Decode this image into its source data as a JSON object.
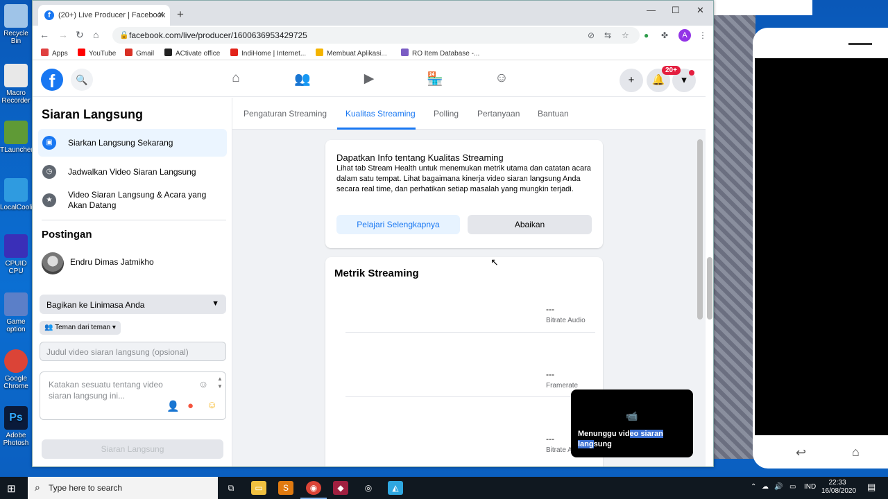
{
  "desktop": {
    "icons": [
      {
        "label": "Recycle Bin",
        "color": "#9fc4e8"
      },
      {
        "label": "Macro Recorder",
        "color": "#e8e8e8"
      },
      {
        "label": "TLauncher",
        "color": "#5f9a36"
      },
      {
        "label": "LocalCooling",
        "color": "#2f9be0"
      },
      {
        "label": "CPUID CPU",
        "color": "#3a2fb8"
      },
      {
        "label": "Game option",
        "color": "#5b7fc8"
      },
      {
        "label": "Google Chrome",
        "color": "#db4437"
      },
      {
        "label": "Adobe Photosh",
        "color": "#0a1a3a"
      }
    ]
  },
  "browser": {
    "tab_title": "(20+) Live Producer | Facebook",
    "url": "facebook.com/live/producer/1600636953429725",
    "bookmarks": [
      {
        "label": "Apps",
        "color": "#e04040"
      },
      {
        "label": "YouTube",
        "color": "#ff0000"
      },
      {
        "label": "Gmail",
        "color": "#d93025"
      },
      {
        "label": "ACtivate office",
        "color": "#222222"
      },
      {
        "label": "IndiHome | Internet...",
        "color": "#e2231a"
      },
      {
        "label": "Membuat Aplikasi...",
        "color": "#f4b400"
      },
      {
        "label": "RO Item Database -...",
        "color": "#7a5cc4"
      }
    ]
  },
  "fb_header": {
    "logo": "f",
    "notification_count": "20+",
    "brand_color": "#1877f2"
  },
  "left_panel": {
    "title": "Siaran Langsung",
    "menu": [
      {
        "label": "Siarkan Langsung Sekarang",
        "icon": "camera-icon"
      },
      {
        "label": "Jadwalkan Video Siaran Langsung",
        "icon": "clock-icon"
      },
      {
        "label": "Video Siaran Langsung & Acara yang Akan Datang",
        "icon": "calendar-icon"
      }
    ],
    "post_section_title": "Postingan",
    "user_name": "Endru Dimas Jatmikho",
    "share_select": "Bagikan ke Linimasa Anda",
    "audience": "Teman dari teman",
    "title_placeholder": "Judul video siaran langsung (opsional)",
    "desc_placeholder": "Katakan sesuatu tentang video siaran langsung ini...",
    "go_live_button": "Siaran Langsung"
  },
  "main": {
    "tabs": [
      {
        "label": "Pengaturan Streaming"
      },
      {
        "label": "Kualitas Streaming"
      },
      {
        "label": "Polling"
      },
      {
        "label": "Pertanyaan"
      },
      {
        "label": "Bantuan"
      }
    ],
    "info_card": {
      "title": "Dapatkan Info tentang Kualitas Streaming",
      "body": "Lihat tab Stream Health untuk menemukan metrik utama dan catatan acara dalam satu tempat. Lihat bagaimana kinerja video siaran langsung Anda secara real time, dan perhatikan setiap masalah yang mungkin terjadi.",
      "learn_more": "Pelajari Selengkapnya",
      "ignore": "Abaikan"
    },
    "metrics_card": {
      "title": "Metrik Streaming",
      "metrics": [
        {
          "value": "---",
          "label": "Bitrate Audio"
        },
        {
          "value": "---",
          "label": "Framerate"
        },
        {
          "value": "---",
          "label": "Bitrate A"
        }
      ]
    }
  },
  "popup": {
    "message_plain": "Menunggu vid",
    "message_selected": "eo siaran",
    "message_selected2": "lang",
    "message_end": "sung"
  },
  "taskbar": {
    "search_placeholder": "Type here to search",
    "language": "IND",
    "time": "22:33",
    "date": "16/08/2020"
  }
}
